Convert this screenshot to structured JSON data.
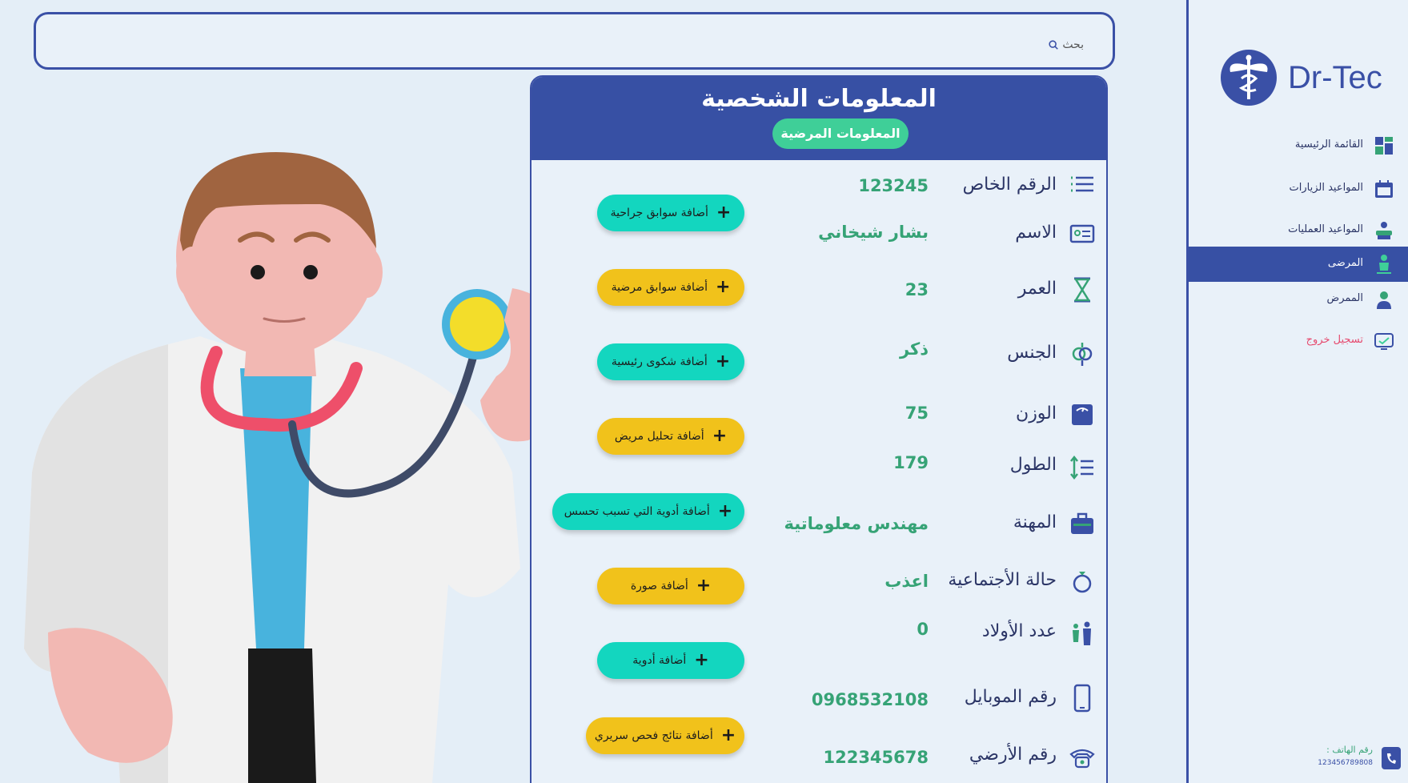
{
  "search": {
    "placeholder": "بحث"
  },
  "brand": {
    "name": "Dr-Tec"
  },
  "sidebar": {
    "items": [
      {
        "label": "القائمة الرئيسية",
        "icon": "dashboard-icon"
      },
      {
        "label": "المواعيد الزيارات",
        "icon": "calendar-icon"
      },
      {
        "label": "المواعيد العمليات",
        "icon": "surgery-icon"
      },
      {
        "label": "المرضى",
        "icon": "patient-icon",
        "active": true
      },
      {
        "label": "الممرض",
        "icon": "nurse-icon"
      },
      {
        "label": "تسجيل خروج",
        "icon": "logout-icon"
      }
    ],
    "phone_label": "رقم الهاتف :",
    "phone_number": "123456789808"
  },
  "card": {
    "title": "المعلومات الشخصية",
    "tab": "المعلومات المرضية",
    "fields": [
      {
        "label": "الرقم الخاص",
        "value": "123245",
        "icon": "list-icon"
      },
      {
        "label": "الاسم",
        "value": "بشار شيخاني",
        "icon": "id-card-icon"
      },
      {
        "label": "العمر",
        "value": "23",
        "icon": "hourglass-icon"
      },
      {
        "label": "الجنس",
        "value": "ذكر",
        "icon": "gender-icon"
      },
      {
        "label": "الوزن",
        "value": "75",
        "icon": "scale-icon"
      },
      {
        "label": "الطول",
        "value": "179",
        "icon": "height-icon"
      },
      {
        "label": "المهنة",
        "value": "مهندس معلوماتية",
        "icon": "briefcase-icon"
      },
      {
        "label": "حالة الأجتماعية",
        "value": "اعذب",
        "icon": "ring-icon"
      },
      {
        "label": "عدد الأولاد",
        "value": "0",
        "icon": "family-icon"
      },
      {
        "label": "رقم الموبايل",
        "value": "0968532108",
        "icon": "mobile-icon"
      },
      {
        "label": "رقم الأرضي",
        "value": "122345678",
        "icon": "telephone-icon"
      }
    ],
    "actions": [
      {
        "label": "أضافة سوابق جراحية",
        "color": "#13d6bf"
      },
      {
        "label": "أضافة سوابق مرضية",
        "color": "#f1c21b"
      },
      {
        "label": "أضافة شكوى رئيسية",
        "color": "#13d6bf"
      },
      {
        "label": "أضافة تحليل مريض",
        "color": "#f1c21b"
      },
      {
        "label": "أضافة أدوية التي تسبب تحسس",
        "color": "#13d6bf"
      },
      {
        "label": "أضافة صورة",
        "color": "#f1c21b"
      },
      {
        "label": "أضافة أدوية",
        "color": "#13d6bf"
      },
      {
        "label": "أضافة نتائج فحص سريري",
        "color": "#f1c21b"
      }
    ]
  },
  "colors": {
    "primary": "#3750a4",
    "accent_green": "#3fcf98",
    "teal": "#13d6bf",
    "yellow": "#f1c21b",
    "value_green": "#36a376",
    "logout_red": "#e64a6e",
    "background": "#e4eef7"
  }
}
